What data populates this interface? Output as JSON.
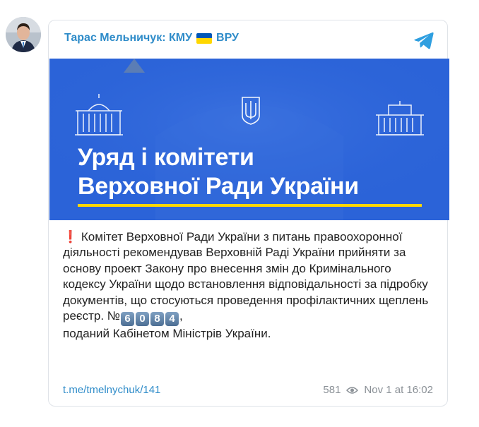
{
  "channel": {
    "name": "Тарас Мельничук: КМУ",
    "suffix": "ВРУ"
  },
  "banner": {
    "title_line1": "Уряд і комітети",
    "title_line2": "Верховної Ради України"
  },
  "post": {
    "text_before_number": "Комітет Верховної Ради України з питань правоохоронної діяльності рекомендував Верховній Раді України прийняти за основу проект Закону про внесення змін до Кримінального кодексу України щодо встановлення відповідальності за підробку документів, що стосуються проведення профілактичних щеплень реєстр. №",
    "number_digits": [
      "6",
      "0",
      "8",
      "4"
    ],
    "text_after_number": ",",
    "text_last": "поданий Кабінетом Міністрів України."
  },
  "footer": {
    "link": "t.me/tmelnychuk/141",
    "views": "581",
    "date": "Nov 1 at 16:02"
  },
  "colors": {
    "link": "#2f8cc9",
    "banner_bg": "#2b63d8",
    "accent_yellow": "#ffd700"
  }
}
